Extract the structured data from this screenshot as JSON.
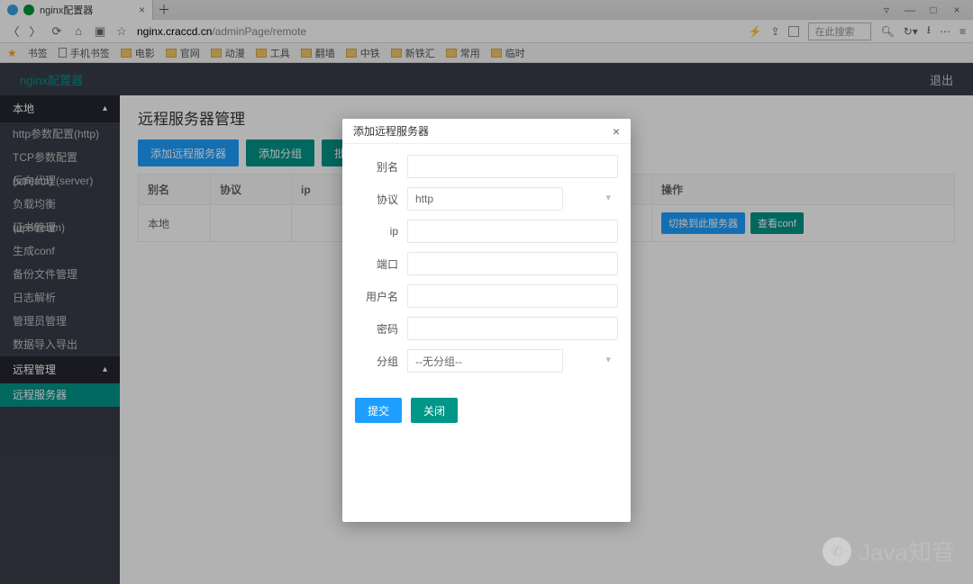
{
  "browser": {
    "tab_title": "nginx配置器",
    "url_host": "nginx.craccd.cn",
    "url_path": "/adminPage/remote",
    "search_placeholder": "在此搜索",
    "bookmarks_label": "书签",
    "mobile_bookmarks": "手机书签",
    "bookmark_folders": [
      "电影",
      "官网",
      "动漫",
      "工具",
      "翻墙",
      "中铁",
      "新铁汇",
      "常用",
      "临时"
    ]
  },
  "header": {
    "brand": "nginx配置器",
    "logout": "退出"
  },
  "sidebar": {
    "groups": [
      {
        "title": "本地",
        "items": [
          "http参数配置(http)",
          "TCP参数配置(stream)",
          "反向代理(server)",
          "负载均衡(upstream)",
          "证书管理",
          "生成conf",
          "备份文件管理",
          "日志解析",
          "管理员管理",
          "数据导入导出"
        ]
      },
      {
        "title": "远程管理",
        "items": [
          "远程服务器"
        ]
      }
    ],
    "active": "远程服务器"
  },
  "page": {
    "title": "远程服务器管理",
    "buttons": {
      "add_server": "添加远程服务器",
      "add_group": "添加分组",
      "batch_cmd": "批量命令"
    },
    "columns": [
      "别名",
      "协议",
      "ip",
      "操作"
    ],
    "rows": [
      {
        "alias": "本地",
        "protocol": "",
        "ip": "",
        "actions": {
          "switch": "切换到此服务器",
          "view": "查看conf"
        }
      }
    ]
  },
  "modal": {
    "title": "添加远程服务器",
    "labels": {
      "alias": "别名",
      "protocol": "协议",
      "ip": "ip",
      "port": "端口",
      "user": "用户名",
      "password": "密码",
      "group": "分组"
    },
    "protocol_value": "http",
    "group_value": "--无分组--",
    "submit": "提交",
    "close": "关闭"
  },
  "watermark": "Java知音"
}
